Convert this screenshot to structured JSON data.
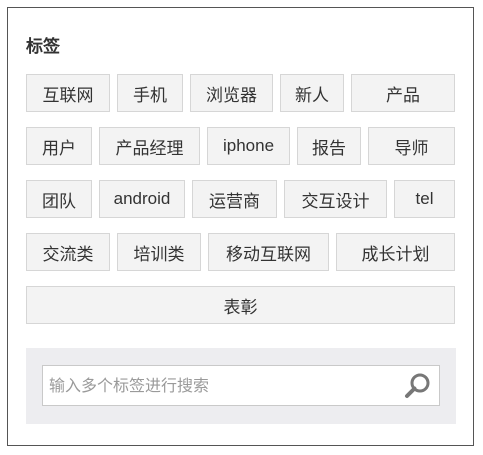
{
  "panel": {
    "title": "标签"
  },
  "tags": [
    "互联网",
    "手机",
    "浏览器",
    "新人",
    "产品",
    "用户",
    "产品经理",
    "iphone",
    "报告",
    "导师",
    "团队",
    "android",
    "运营商",
    "交互设计",
    "tel",
    "交流类",
    "培训类",
    "移动互联网",
    "成长计划",
    "表彰"
  ],
  "search": {
    "placeholder": "输入多个标签进行搜索",
    "value": "",
    "icon": "search-icon"
  }
}
